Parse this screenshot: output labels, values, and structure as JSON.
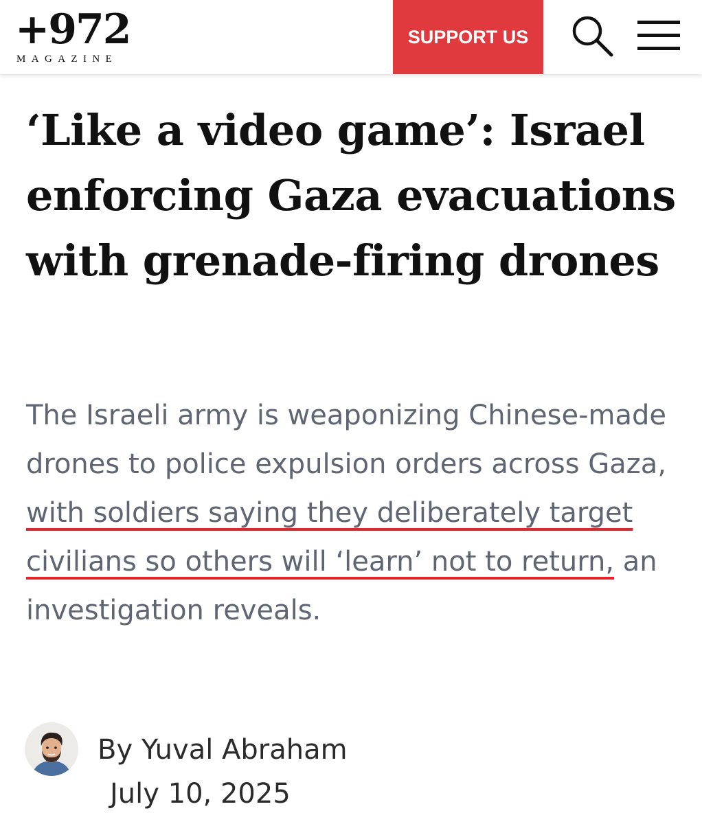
{
  "header": {
    "logo_mark": "+972",
    "logo_sub": "MAGAZINE",
    "support_label": "SUPPORT US",
    "support_color": "#e03a3e",
    "search_icon": "search-icon",
    "menu_icon": "hamburger-menu-icon"
  },
  "article": {
    "headline": "‘Like a video game’: Israel enforcing Gaza evacuations with grenade-firing drones",
    "subhead": {
      "part1": "The Israeli army is weaponizing Chinese-made drones to police expulsion orders across Gaza, ",
      "underlined": "with soldiers saying they deliberately target civilians so others will ‘learn’ not to return,",
      "part2": " an investigation reveals."
    },
    "highlight_color": "#e8242b",
    "byline": {
      "author": "By Yuval Abraham",
      "date": "July 10, 2025"
    }
  }
}
